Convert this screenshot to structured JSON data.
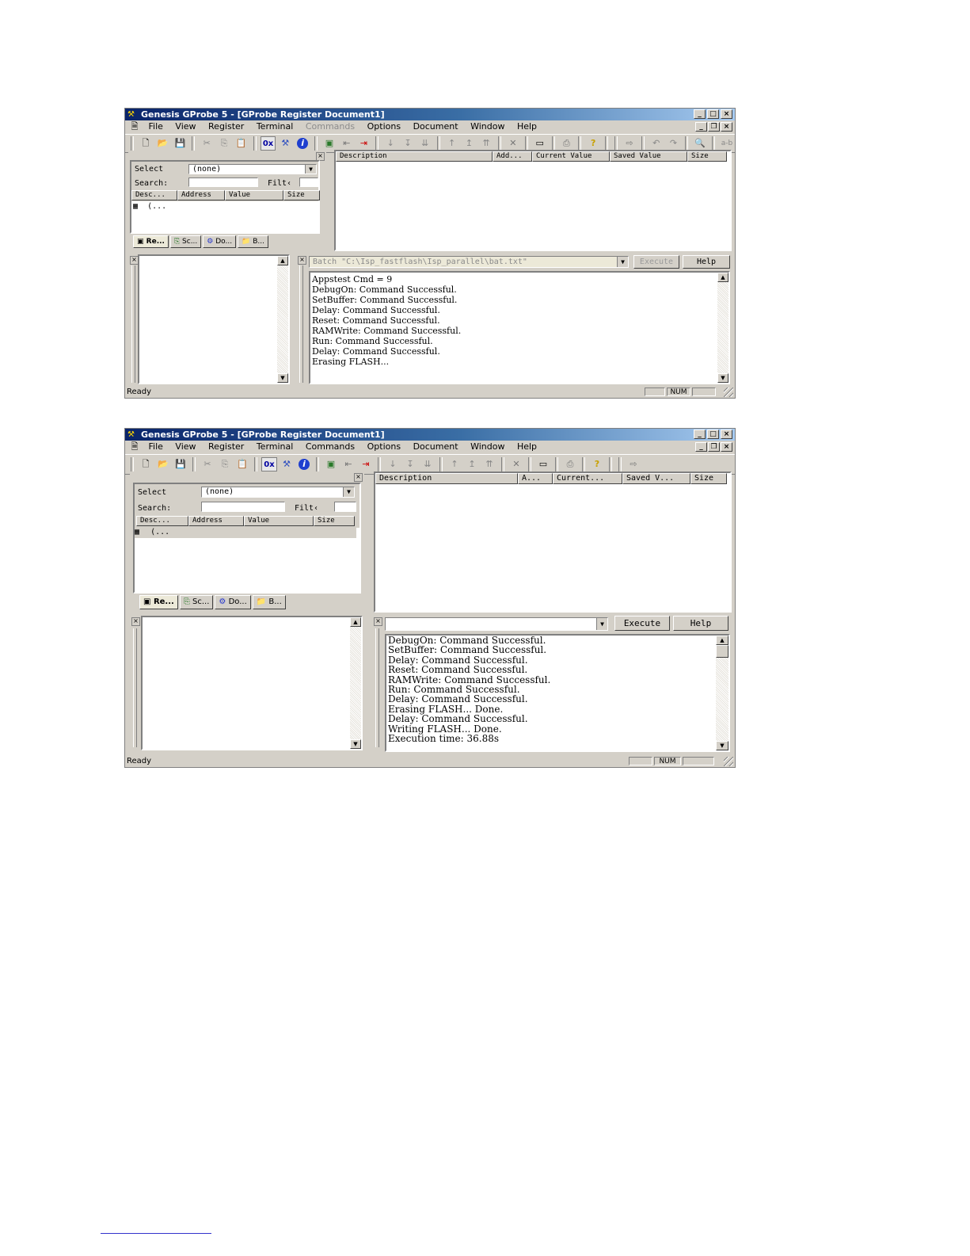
{
  "screenshot1": {
    "title": "Genesis GProbe 5 - [GProbe Register Document1]",
    "menus": [
      {
        "label": "File",
        "disabled": false
      },
      {
        "label": "View",
        "disabled": false
      },
      {
        "label": "Register",
        "disabled": false
      },
      {
        "label": "Terminal",
        "disabled": false
      },
      {
        "label": "Commands",
        "disabled": true
      },
      {
        "label": "Options",
        "disabled": false
      },
      {
        "label": "Document",
        "disabled": false
      },
      {
        "label": "Window",
        "disabled": false
      },
      {
        "label": "Help",
        "disabled": false
      }
    ],
    "left_panel": {
      "select_label": "Select",
      "select_value": "(none)",
      "search_label": "Search:",
      "filter_label": "Filt‹",
      "columns": [
        "Desc...",
        "Address",
        "Value",
        "Size"
      ],
      "row": "(...",
      "tabs": [
        "Re...",
        "Sc...",
        "Do...",
        "B..."
      ]
    },
    "register_columns": [
      "Description",
      "Add...",
      "Current Value",
      "Saved Value",
      "Size"
    ],
    "batch_combo": "Batch  \"C:\\Isp_fastflash\\Isp_parallel\\bat.txt\"",
    "execute_label": "Execute",
    "help_label": "Help",
    "output_lines": [
      "Appstest Cmd = 9",
      "DebugOn: Command Successful.",
      "SetBuffer: Command Successful.",
      "Delay: Command Successful.",
      "Reset: Command Successful.",
      "RAMWrite: Command Successful.",
      "Run: Command Successful.",
      "Delay: Command Successful.",
      "Erasing FLASH..."
    ],
    "status": "Ready",
    "num": "NUM"
  },
  "screenshot2": {
    "title": "Genesis GProbe 5 - [GProbe Register Document1]",
    "menus": [
      {
        "label": "File",
        "disabled": false
      },
      {
        "label": "View",
        "disabled": false
      },
      {
        "label": "Register",
        "disabled": false
      },
      {
        "label": "Terminal",
        "disabled": false
      },
      {
        "label": "Commands",
        "disabled": false
      },
      {
        "label": "Options",
        "disabled": false
      },
      {
        "label": "Document",
        "disabled": false
      },
      {
        "label": "Window",
        "disabled": false
      },
      {
        "label": "Help",
        "disabled": false
      }
    ],
    "left_panel": {
      "select_label": "Select",
      "select_value": "(none)",
      "search_label": "Search:",
      "filter_label": "Filt‹",
      "columns": [
        "Desc...",
        "Address",
        "Value",
        "Size"
      ],
      "row": "(...",
      "tabs": [
        "Re...",
        "Sc...",
        "Do...",
        "B..."
      ]
    },
    "register_columns": [
      "Description",
      "A...",
      "Current...",
      "Saved V...",
      "Size"
    ],
    "batch_combo": "",
    "execute_label": "Execute",
    "help_label": "Help",
    "output_lines": [
      "DebugOn: Command Successful.",
      "SetBuffer: Command Successful.",
      "Delay: Command Successful.",
      "Reset: Command Successful.",
      "RAMWrite: Command Successful.",
      "Run: Command Successful.",
      "Delay: Command Successful.",
      "Erasing FLASH... Done.",
      "Delay: Command Successful.",
      "Writing FLASH... Done.",
      "Execution time: 36.88s"
    ],
    "status": "Ready",
    "num": "NUM"
  },
  "toolbar_icons": [
    "new-icon",
    "open-icon",
    "save-icon",
    "cut-icon",
    "copy-icon",
    "paste-icon",
    "hex-icon",
    "probe-icon",
    "info-icon",
    "chip-icon",
    "arrow-left-icon",
    "stop-icon",
    "step-in-icon",
    "step-over-icon",
    "step-down-icon",
    "step-up-icon",
    "step-out-icon",
    "step-top-icon",
    "delete-icon",
    "window-icon",
    "print-icon",
    "help-icon",
    "send-icon",
    "undo-icon",
    "redo-icon",
    "find-icon",
    "ab-icon"
  ]
}
